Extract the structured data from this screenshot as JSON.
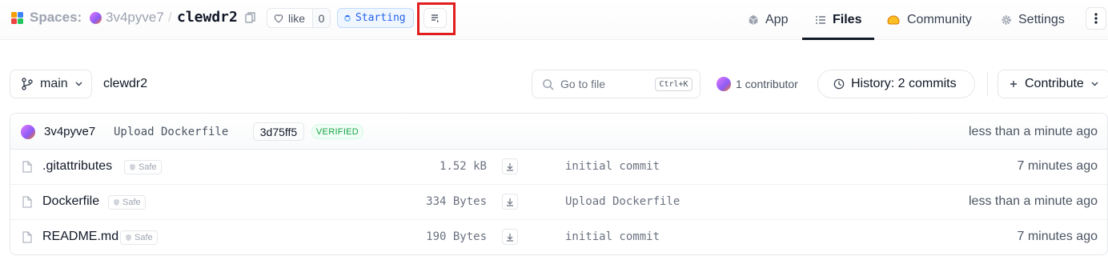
{
  "header": {
    "section": "Spaces:",
    "owner": "3v4pyve7",
    "separator": "/",
    "repo": "clewdr2",
    "like_label": "like",
    "like_count": "0",
    "status": "Starting",
    "nav": [
      {
        "label": "App",
        "icon": "cube-icon"
      },
      {
        "label": "Files",
        "icon": "files-icon",
        "active": true
      },
      {
        "label": "Community",
        "icon": "community-icon"
      },
      {
        "label": "Settings",
        "icon": "gear-icon"
      }
    ],
    "logo_colors": [
      "#f59e0b",
      "#3b82f6",
      "#ef4444",
      "#22c55e"
    ]
  },
  "toolbar": {
    "branch": "main",
    "breadcrumb": "clewdr2",
    "search_placeholder": "Go to file",
    "search_shortcut": "Ctrl+K",
    "contributors": "1 contributor",
    "history": "History: 2 commits",
    "contribute": "Contribute"
  },
  "last_commit": {
    "author": "3v4pyve7",
    "message": "Upload Dockerfile",
    "sha": "3d75ff5",
    "badge": "VERIFIED",
    "time": "less than a minute ago"
  },
  "files": [
    {
      "name": ".gitattributes",
      "badge": "Safe",
      "size": "1.52 kB",
      "commit": "initial commit",
      "time": "7 minutes ago"
    },
    {
      "name": "Dockerfile",
      "badge": "Safe",
      "size": "334 Bytes",
      "commit": "Upload Dockerfile",
      "time": "less than a minute ago"
    },
    {
      "name": "README.md",
      "badge": "Safe",
      "size": "190 Bytes",
      "commit": "initial commit",
      "time": "7 minutes ago"
    }
  ],
  "colors": {
    "accent_highlight": "#e11d1d",
    "status_blue": "#2563eb",
    "verified_green": "#16a34a"
  }
}
